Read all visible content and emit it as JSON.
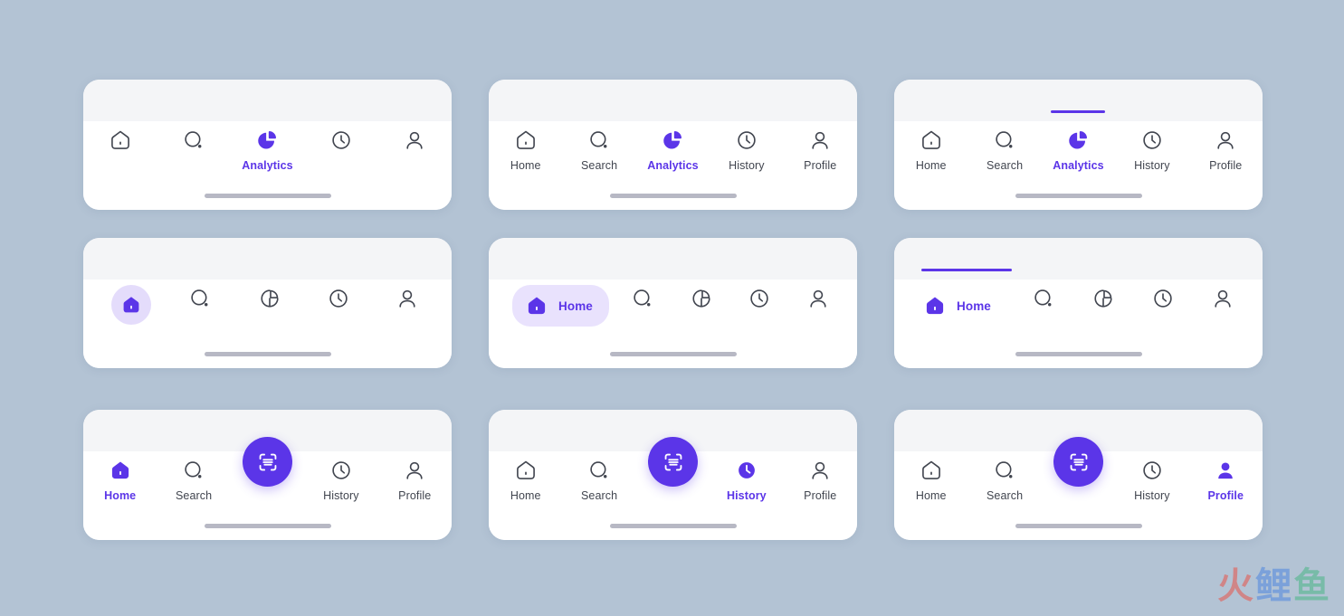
{
  "page": {
    "background_color": "#b3c3d4",
    "accent_color": "#5b35e8",
    "accent_tint_color": "#e9e2fd",
    "inactive_color": "#41454f",
    "card_top_color": "#f4f5f7",
    "card_color": "#ffffff"
  },
  "labels": {
    "home": "Home",
    "search": "Search",
    "analytics": "Analytics",
    "history": "History",
    "profile": "Profile"
  },
  "watermark": {
    "char1": "火",
    "char2": "鲤",
    "char3": "鱼"
  },
  "cards": [
    {
      "id": "card-icons-only-analytics",
      "variant": "icon-only-active-label",
      "active_index": 2,
      "indicator": "none",
      "fab": false,
      "items": [
        {
          "name": "home",
          "icon": "home-icon",
          "label": "Home",
          "show_label": false,
          "active": false
        },
        {
          "name": "search",
          "icon": "search-icon",
          "label": "Search",
          "show_label": false,
          "active": false
        },
        {
          "name": "analytics",
          "icon": "analytics-pie-icon",
          "label": "Analytics",
          "show_label": true,
          "active": true
        },
        {
          "name": "history",
          "icon": "history-clock-icon",
          "label": "History",
          "show_label": false,
          "active": false
        },
        {
          "name": "profile",
          "icon": "profile-person-icon",
          "label": "Profile",
          "show_label": false,
          "active": false
        }
      ]
    },
    {
      "id": "card-labels-analytics",
      "variant": "all-labels",
      "active_index": 2,
      "indicator": "none",
      "fab": false,
      "items": [
        {
          "name": "home",
          "icon": "home-icon",
          "label": "Home",
          "show_label": true,
          "active": false
        },
        {
          "name": "search",
          "icon": "search-icon",
          "label": "Search",
          "show_label": true,
          "active": false
        },
        {
          "name": "analytics",
          "icon": "analytics-pie-icon",
          "label": "Analytics",
          "show_label": true,
          "active": true
        },
        {
          "name": "history",
          "icon": "history-clock-icon",
          "label": "History",
          "show_label": true,
          "active": false
        },
        {
          "name": "profile",
          "icon": "profile-person-icon",
          "label": "Profile",
          "show_label": true,
          "active": false
        }
      ]
    },
    {
      "id": "card-labels-analytics-indicator",
      "variant": "all-labels-top-indicator",
      "active_index": 2,
      "indicator": "top-bar",
      "fab": false,
      "items": [
        {
          "name": "home",
          "icon": "home-icon",
          "label": "Home",
          "show_label": true,
          "active": false
        },
        {
          "name": "search",
          "icon": "search-icon",
          "label": "Search",
          "show_label": true,
          "active": false
        },
        {
          "name": "analytics",
          "icon": "analytics-pie-icon",
          "label": "Analytics",
          "show_label": true,
          "active": true
        },
        {
          "name": "history",
          "icon": "history-clock-icon",
          "label": "History",
          "show_label": true,
          "active": false
        },
        {
          "name": "profile",
          "icon": "profile-person-icon",
          "label": "Profile",
          "show_label": true,
          "active": false
        }
      ]
    },
    {
      "id": "card-circle-badge-home",
      "variant": "icon-only-circle-badge",
      "active_index": 0,
      "indicator": "none",
      "fab": false,
      "items": [
        {
          "name": "home",
          "icon": "home-filled-icon",
          "label": "Home",
          "show_label": false,
          "active": true
        },
        {
          "name": "search",
          "icon": "search-icon",
          "label": "Search",
          "show_label": false,
          "active": false
        },
        {
          "name": "analytics",
          "icon": "analytics-pie-outline-icon",
          "label": "Analytics",
          "show_label": false,
          "active": false
        },
        {
          "name": "history",
          "icon": "history-clock-icon",
          "label": "History",
          "show_label": false,
          "active": false
        },
        {
          "name": "profile",
          "icon": "profile-person-icon",
          "label": "Profile",
          "show_label": false,
          "active": false
        }
      ]
    },
    {
      "id": "card-pill-home",
      "variant": "pill-active-left",
      "active_index": 0,
      "indicator": "none",
      "fab": false,
      "items": [
        {
          "name": "home",
          "icon": "home-filled-icon",
          "label": "Home",
          "show_label": true,
          "active": true
        },
        {
          "name": "search",
          "icon": "search-icon",
          "label": "Search",
          "show_label": false,
          "active": false
        },
        {
          "name": "analytics",
          "icon": "analytics-pie-outline-icon",
          "label": "Analytics",
          "show_label": false,
          "active": false
        },
        {
          "name": "history",
          "icon": "history-clock-icon",
          "label": "History",
          "show_label": false,
          "active": false
        },
        {
          "name": "profile",
          "icon": "profile-person-icon",
          "label": "Profile",
          "show_label": false,
          "active": false
        }
      ]
    },
    {
      "id": "card-pill-home-indicator",
      "variant": "plain-active-left-top-indicator",
      "active_index": 0,
      "indicator": "top-bar-left",
      "fab": false,
      "items": [
        {
          "name": "home",
          "icon": "home-filled-icon",
          "label": "Home",
          "show_label": true,
          "active": true
        },
        {
          "name": "search",
          "icon": "search-icon",
          "label": "Search",
          "show_label": false,
          "active": false
        },
        {
          "name": "analytics",
          "icon": "analytics-pie-outline-icon",
          "label": "Analytics",
          "show_label": false,
          "active": false
        },
        {
          "name": "history",
          "icon": "history-clock-icon",
          "label": "History",
          "show_label": false,
          "active": false
        },
        {
          "name": "profile",
          "icon": "profile-person-icon",
          "label": "Profile",
          "show_label": false,
          "active": false
        }
      ]
    },
    {
      "id": "card-fab-home",
      "variant": "fab-center",
      "active_index": 0,
      "indicator": "none",
      "fab": true,
      "fab_icon": "scan-icon",
      "items": [
        {
          "name": "home",
          "icon": "home-filled-icon",
          "label": "Home",
          "show_label": true,
          "active": true
        },
        {
          "name": "search",
          "icon": "search-icon",
          "label": "Search",
          "show_label": true,
          "active": false
        },
        {
          "name": "scan",
          "icon": "scan-icon",
          "label": "",
          "show_label": false,
          "active": false,
          "is_fab": true
        },
        {
          "name": "history",
          "icon": "history-clock-icon",
          "label": "History",
          "show_label": true,
          "active": false
        },
        {
          "name": "profile",
          "icon": "profile-person-icon",
          "label": "Profile",
          "show_label": true,
          "active": false
        }
      ]
    },
    {
      "id": "card-fab-history",
      "variant": "fab-center",
      "active_index": 3,
      "indicator": "none",
      "fab": true,
      "fab_icon": "scan-icon",
      "items": [
        {
          "name": "home",
          "icon": "home-icon",
          "label": "Home",
          "show_label": true,
          "active": false
        },
        {
          "name": "search",
          "icon": "search-icon",
          "label": "Search",
          "show_label": true,
          "active": false
        },
        {
          "name": "scan",
          "icon": "scan-icon",
          "label": "",
          "show_label": false,
          "active": false,
          "is_fab": true
        },
        {
          "name": "history",
          "icon": "history-clock-filled-icon",
          "label": "History",
          "show_label": true,
          "active": true
        },
        {
          "name": "profile",
          "icon": "profile-person-icon",
          "label": "Profile",
          "show_label": true,
          "active": false
        }
      ]
    },
    {
      "id": "card-fab-profile",
      "variant": "fab-center",
      "active_index": 4,
      "indicator": "none",
      "fab": true,
      "fab_icon": "scan-icon",
      "items": [
        {
          "name": "home",
          "icon": "home-icon",
          "label": "Home",
          "show_label": true,
          "active": false
        },
        {
          "name": "search",
          "icon": "search-icon",
          "label": "Search",
          "show_label": true,
          "active": false
        },
        {
          "name": "scan",
          "icon": "scan-icon",
          "label": "",
          "show_label": false,
          "active": false,
          "is_fab": true
        },
        {
          "name": "history",
          "icon": "history-clock-icon",
          "label": "History",
          "show_label": true,
          "active": false
        },
        {
          "name": "profile",
          "icon": "profile-person-filled-icon",
          "label": "Profile",
          "show_label": true,
          "active": true
        }
      ]
    }
  ]
}
